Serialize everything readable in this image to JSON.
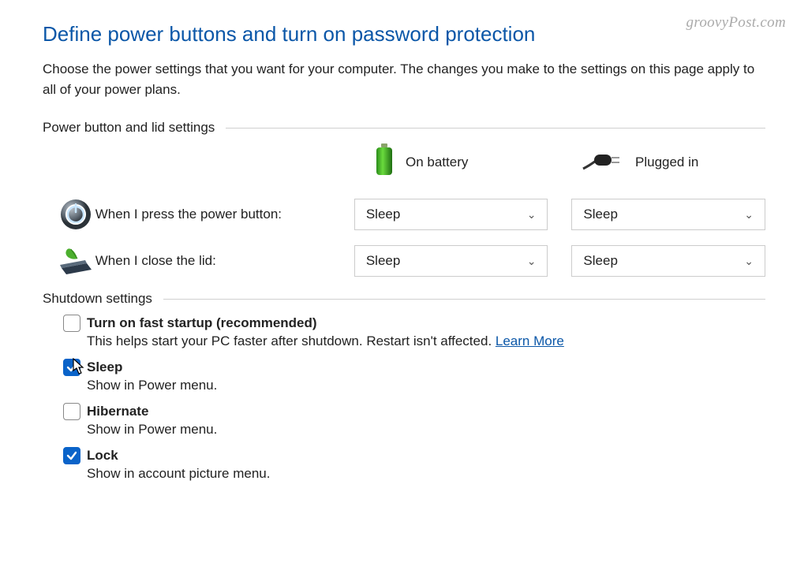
{
  "watermark": "groovyPost.com",
  "page": {
    "title": "Define power buttons and turn on password protection",
    "description": "Choose the power settings that you want for your computer. The changes you make to the settings on this page apply to all of your power plans."
  },
  "sections": {
    "power_lid": {
      "header": "Power button and lid settings",
      "columns": {
        "battery": "On battery",
        "plugged": "Plugged in"
      },
      "rows": {
        "power_button": {
          "label": "When I press the power button:",
          "battery_value": "Sleep",
          "plugged_value": "Sleep"
        },
        "close_lid": {
          "label": "When I close the lid:",
          "battery_value": "Sleep",
          "plugged_value": "Sleep"
        }
      }
    },
    "shutdown": {
      "header": "Shutdown settings",
      "options": {
        "fast_startup": {
          "checked": false,
          "label": "Turn on fast startup (recommended)",
          "desc": "This helps start your PC faster after shutdown. Restart isn't affected. ",
          "learn_more": "Learn More"
        },
        "sleep": {
          "checked": true,
          "label": "Sleep",
          "desc": "Show in Power menu."
        },
        "hibernate": {
          "checked": false,
          "label": "Hibernate",
          "desc": "Show in Power menu."
        },
        "lock": {
          "checked": true,
          "label": "Lock",
          "desc": "Show in account picture menu."
        }
      }
    }
  }
}
